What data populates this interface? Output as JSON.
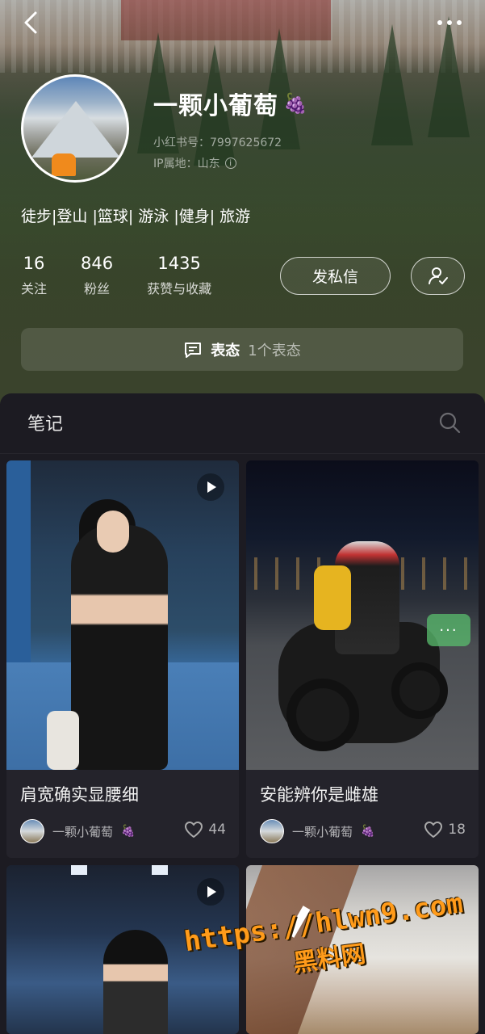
{
  "profile": {
    "username": "一颗小葡萄",
    "username_emoji": "🍇",
    "id_text": "小红书号：7997625672",
    "ip_text": "IP属地：山东",
    "bio": "徒步|登山 |篮球| 游泳 |健身| 旅游",
    "stats": [
      {
        "value": "16",
        "label": "关注"
      },
      {
        "value": "846",
        "label": "粉丝"
      },
      {
        "value": "1435",
        "label": "获赞与收藏"
      }
    ],
    "message_button": "发私信",
    "status": {
      "label": "表态",
      "count": "1个表态"
    }
  },
  "notes": {
    "header": "笔记",
    "cards": [
      {
        "title": "肩宽确实显腰细",
        "author": "一颗小葡萄",
        "likes": "44"
      },
      {
        "title": "安能辨你是雌雄",
        "author": "一颗小葡萄",
        "likes": "18"
      }
    ],
    "bubble_text": "···"
  },
  "watermark": {
    "url": "https://hlwn9.com",
    "label": "黑料网"
  },
  "icons": [
    "back-icon",
    "more-icon",
    "info-icon",
    "follow-user-icon",
    "comment-icon",
    "search-icon",
    "heart-icon",
    "play-icon",
    "grape-icon"
  ]
}
